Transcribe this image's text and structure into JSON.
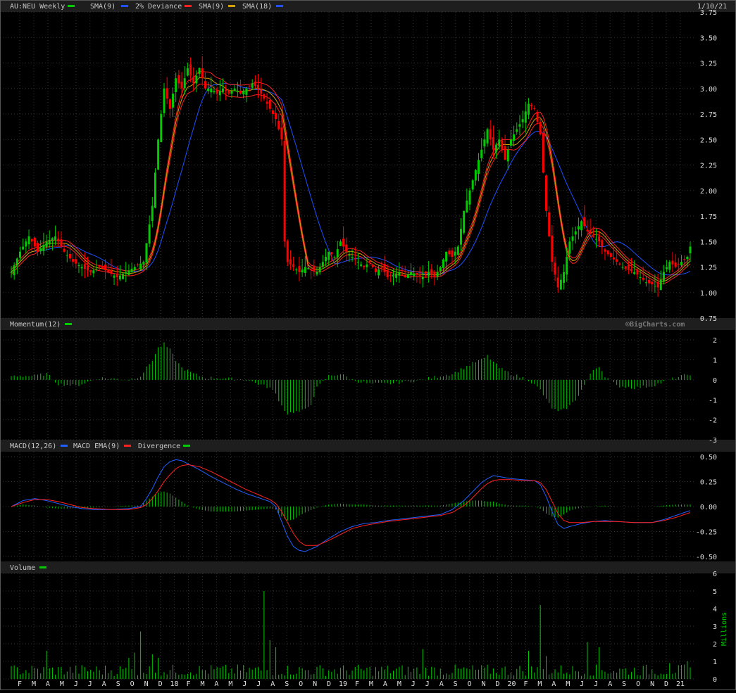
{
  "colors": {
    "bg": "#000000",
    "header_bg": "#202020",
    "grid": "#333333",
    "text": "#c8c8c8",
    "axis_text": "#e0e0e0",
    "up": "#00cc00",
    "down": "#ff0000",
    "volume": "#00cc00",
    "sma9": "#ff2020",
    "sma18": "#2050ff",
    "dev": "#d4a000",
    "macd": "#2060ff",
    "macd_ema": "#ff2020",
    "divergence": "#00cc00"
  },
  "header": {
    "price": {
      "symbol": "AU:NEU Weekly",
      "legend": [
        {
          "label": "SMA(9)",
          "color": "#00cc00"
        },
        {
          "label": "2% Deviance",
          "color": "#2050ff"
        },
        {
          "label": "SMA(9)",
          "color": "#ff2020"
        },
        {
          "label": "SMA(18)",
          "color": "#d4a000"
        }
      ],
      "last_legend_color": "#2050ff",
      "date": "1/10/21"
    },
    "momentum": {
      "label": "Momentum(12)",
      "color": "#00cc00"
    },
    "macd": {
      "legend": [
        {
          "label": "MACD(12,26)",
          "color": "#2060ff"
        },
        {
          "label": "MACD EMA(9)",
          "color": "#ff2020"
        },
        {
          "label": "Divergence",
          "color": "#00cc00"
        }
      ]
    },
    "volume": {
      "label": "Volume",
      "color": "#00cc00"
    }
  },
  "watermark": "©BigCharts.com",
  "volume_units": "Millions",
  "chart_data": [
    {
      "type": "candlestick",
      "name": "price",
      "ylim": [
        0.75,
        3.75
      ],
      "yticks": [
        "0.75",
        "1.00",
        "1.25",
        "1.50",
        "1.75",
        "2.00",
        "2.25",
        "2.50",
        "2.75",
        "3.00",
        "3.25",
        "3.50",
        "3.75"
      ],
      "anchors": [
        [
          0,
          1.2
        ],
        [
          3,
          1.4
        ],
        [
          6,
          1.55
        ],
        [
          9,
          1.4
        ],
        [
          12,
          1.5
        ],
        [
          15,
          1.55
        ],
        [
          18,
          1.4
        ],
        [
          21,
          1.3
        ],
        [
          24,
          1.25
        ],
        [
          27,
          1.2
        ],
        [
          30,
          1.25
        ],
        [
          33,
          1.2
        ],
        [
          36,
          1.15
        ],
        [
          39,
          1.2
        ],
        [
          42,
          1.25
        ],
        [
          45,
          1.3
        ],
        [
          48,
          1.85
        ],
        [
          50,
          2.5
        ],
        [
          52,
          3.0
        ],
        [
          54,
          2.8
        ],
        [
          56,
          3.1
        ],
        [
          58,
          3.0
        ],
        [
          60,
          3.2
        ],
        [
          62,
          3.05
        ],
        [
          64,
          3.2
        ],
        [
          66,
          3.0
        ],
        [
          68,
          3.0
        ],
        [
          70,
          2.95
        ],
        [
          72,
          3.0
        ],
        [
          74,
          2.95
        ],
        [
          76,
          3.0
        ],
        [
          78,
          2.95
        ],
        [
          80,
          3.0
        ],
        [
          82,
          3.05
        ],
        [
          84,
          3.0
        ],
        [
          86,
          2.9
        ],
        [
          88,
          2.8
        ],
        [
          90,
          2.7
        ],
        [
          92,
          2.5
        ],
        [
          93,
          1.5
        ],
        [
          94,
          1.3
        ],
        [
          96,
          1.25
        ],
        [
          98,
          1.2
        ],
        [
          100,
          1.25
        ],
        [
          104,
          1.2
        ],
        [
          106,
          1.3
        ],
        [
          108,
          1.4
        ],
        [
          110,
          1.35
        ],
        [
          112,
          1.5
        ],
        [
          114,
          1.4
        ],
        [
          116,
          1.35
        ],
        [
          118,
          1.3
        ],
        [
          120,
          1.25
        ],
        [
          122,
          1.3
        ],
        [
          124,
          1.2
        ],
        [
          126,
          1.25
        ],
        [
          128,
          1.15
        ],
        [
          132,
          1.2
        ],
        [
          134,
          1.15
        ],
        [
          136,
          1.2
        ],
        [
          140,
          1.15
        ],
        [
          142,
          1.2
        ],
        [
          144,
          1.15
        ],
        [
          146,
          1.25
        ],
        [
          148,
          1.4
        ],
        [
          150,
          1.35
        ],
        [
          152,
          1.45
        ],
        [
          154,
          1.8
        ],
        [
          156,
          2.0
        ],
        [
          158,
          2.2
        ],
        [
          160,
          2.4
        ],
        [
          162,
          2.6
        ],
        [
          164,
          2.4
        ],
        [
          166,
          2.5
        ],
        [
          168,
          2.3
        ],
        [
          170,
          2.5
        ],
        [
          172,
          2.6
        ],
        [
          174,
          2.7
        ],
        [
          176,
          2.85
        ],
        [
          178,
          2.8
        ],
        [
          180,
          2.55
        ],
        [
          182,
          1.8
        ],
        [
          184,
          1.3
        ],
        [
          186,
          1.05
        ],
        [
          188,
          1.2
        ],
        [
          190,
          1.5
        ],
        [
          192,
          1.6
        ],
        [
          194,
          1.7
        ],
        [
          196,
          1.6
        ],
        [
          198,
          1.55
        ],
        [
          200,
          1.5
        ],
        [
          202,
          1.4
        ],
        [
          204,
          1.35
        ],
        [
          206,
          1.3
        ],
        [
          208,
          1.25
        ],
        [
          210,
          1.22
        ],
        [
          212,
          1.2
        ],
        [
          214,
          1.15
        ],
        [
          216,
          1.1
        ],
        [
          218,
          1.08
        ],
        [
          220,
          1.05
        ],
        [
          222,
          1.2
        ],
        [
          224,
          1.3
        ],
        [
          226,
          1.25
        ],
        [
          228,
          1.3
        ],
        [
          230,
          1.35
        ],
        [
          231,
          1.45
        ]
      ]
    },
    {
      "type": "bar",
      "name": "Momentum(12)",
      "ylim": [
        -3,
        2.5
      ],
      "yticks": [
        "2",
        "1",
        "0",
        "-1",
        "-2",
        "-3"
      ],
      "anchors": [
        [
          0,
          0.2
        ],
        [
          8,
          0.2
        ],
        [
          12,
          0.3
        ],
        [
          16,
          -0.2
        ],
        [
          22,
          -0.3
        ],
        [
          30,
          0.1
        ],
        [
          40,
          0.0
        ],
        [
          44,
          0.2
        ],
        [
          46,
          0.6
        ],
        [
          48,
          1.0
        ],
        [
          50,
          1.6
        ],
        [
          52,
          1.8
        ],
        [
          54,
          1.5
        ],
        [
          56,
          1.0
        ],
        [
          58,
          0.6
        ],
        [
          62,
          0.3
        ],
        [
          66,
          0.1
        ],
        [
          70,
          0.1
        ],
        [
          80,
          0.0
        ],
        [
          84,
          -0.2
        ],
        [
          88,
          -0.4
        ],
        [
          90,
          -0.7
        ],
        [
          92,
          -1.3
        ],
        [
          94,
          -1.7
        ],
        [
          96,
          -1.6
        ],
        [
          98,
          -1.6
        ],
        [
          100,
          -1.5
        ],
        [
          102,
          -1.2
        ],
        [
          104,
          -0.4
        ],
        [
          108,
          0.2
        ],
        [
          112,
          0.3
        ],
        [
          116,
          0.0
        ],
        [
          122,
          -0.2
        ],
        [
          128,
          -0.2
        ],
        [
          134,
          -0.1
        ],
        [
          140,
          0.0
        ],
        [
          146,
          0.2
        ],
        [
          150,
          0.3
        ],
        [
          154,
          0.6
        ],
        [
          158,
          0.9
        ],
        [
          160,
          1.0
        ],
        [
          162,
          1.2
        ],
        [
          164,
          0.9
        ],
        [
          166,
          0.6
        ],
        [
          170,
          0.3
        ],
        [
          176,
          0.0
        ],
        [
          180,
          -0.5
        ],
        [
          182,
          -1.0
        ],
        [
          184,
          -1.4
        ],
        [
          186,
          -1.6
        ],
        [
          188,
          -1.5
        ],
        [
          190,
          -1.3
        ],
        [
          192,
          -1.0
        ],
        [
          194,
          -0.5
        ],
        [
          196,
          0.0
        ],
        [
          198,
          0.5
        ],
        [
          200,
          0.7
        ],
        [
          202,
          0.2
        ],
        [
          206,
          -0.3
        ],
        [
          212,
          -0.4
        ],
        [
          218,
          -0.3
        ],
        [
          222,
          -0.1
        ],
        [
          226,
          0.1
        ],
        [
          231,
          0.3
        ]
      ]
    },
    {
      "type": "line",
      "name": "MACD(12,26)",
      "ylim": [
        -0.55,
        0.55
      ],
      "yticks": [
        "0.50",
        "0.25",
        "0.00",
        "-0.25",
        "-0.50"
      ],
      "macd": [
        [
          0,
          0.0
        ],
        [
          4,
          0.06
        ],
        [
          8,
          0.08
        ],
        [
          12,
          0.06
        ],
        [
          16,
          0.03
        ],
        [
          20,
          0.0
        ],
        [
          24,
          -0.02
        ],
        [
          28,
          -0.03
        ],
        [
          34,
          -0.03
        ],
        [
          40,
          -0.02
        ],
        [
          44,
          0.0
        ],
        [
          46,
          0.08
        ],
        [
          48,
          0.18
        ],
        [
          50,
          0.3
        ],
        [
          52,
          0.4
        ],
        [
          54,
          0.45
        ],
        [
          56,
          0.47
        ],
        [
          58,
          0.46
        ],
        [
          60,
          0.43
        ],
        [
          64,
          0.37
        ],
        [
          68,
          0.3
        ],
        [
          72,
          0.24
        ],
        [
          76,
          0.18
        ],
        [
          80,
          0.13
        ],
        [
          84,
          0.09
        ],
        [
          88,
          0.05
        ],
        [
          90,
          0.0
        ],
        [
          92,
          -0.15
        ],
        [
          94,
          -0.3
        ],
        [
          96,
          -0.4
        ],
        [
          98,
          -0.44
        ],
        [
          100,
          -0.45
        ],
        [
          104,
          -0.4
        ],
        [
          108,
          -0.32
        ],
        [
          112,
          -0.25
        ],
        [
          116,
          -0.2
        ],
        [
          120,
          -0.17
        ],
        [
          124,
          -0.16
        ],
        [
          128,
          -0.14
        ],
        [
          134,
          -0.12
        ],
        [
          140,
          -0.1
        ],
        [
          146,
          -0.08
        ],
        [
          150,
          -0.03
        ],
        [
          154,
          0.06
        ],
        [
          156,
          0.12
        ],
        [
          158,
          0.18
        ],
        [
          160,
          0.24
        ],
        [
          162,
          0.28
        ],
        [
          164,
          0.31
        ],
        [
          166,
          0.3
        ],
        [
          170,
          0.28
        ],
        [
          174,
          0.27
        ],
        [
          178,
          0.26
        ],
        [
          180,
          0.22
        ],
        [
          182,
          0.1
        ],
        [
          184,
          -0.05
        ],
        [
          186,
          -0.18
        ],
        [
          188,
          -0.22
        ],
        [
          190,
          -0.2
        ],
        [
          194,
          -0.17
        ],
        [
          198,
          -0.15
        ],
        [
          202,
          -0.14
        ],
        [
          206,
          -0.15
        ],
        [
          212,
          -0.16
        ],
        [
          218,
          -0.16
        ],
        [
          222,
          -0.13
        ],
        [
          226,
          -0.09
        ],
        [
          231,
          -0.04
        ]
      ],
      "ema": [
        [
          0,
          0.0
        ],
        [
          4,
          0.04
        ],
        [
          8,
          0.07
        ],
        [
          12,
          0.07
        ],
        [
          16,
          0.05
        ],
        [
          20,
          0.02
        ],
        [
          24,
          -0.01
        ],
        [
          28,
          -0.02
        ],
        [
          34,
          -0.03
        ],
        [
          40,
          -0.03
        ],
        [
          44,
          -0.01
        ],
        [
          46,
          0.02
        ],
        [
          48,
          0.08
        ],
        [
          50,
          0.16
        ],
        [
          52,
          0.25
        ],
        [
          54,
          0.32
        ],
        [
          56,
          0.38
        ],
        [
          58,
          0.41
        ],
        [
          60,
          0.42
        ],
        [
          64,
          0.4
        ],
        [
          68,
          0.35
        ],
        [
          72,
          0.29
        ],
        [
          76,
          0.23
        ],
        [
          80,
          0.17
        ],
        [
          84,
          0.12
        ],
        [
          88,
          0.07
        ],
        [
          90,
          0.03
        ],
        [
          92,
          -0.05
        ],
        [
          94,
          -0.16
        ],
        [
          96,
          -0.27
        ],
        [
          98,
          -0.35
        ],
        [
          100,
          -0.39
        ],
        [
          104,
          -0.39
        ],
        [
          108,
          -0.34
        ],
        [
          112,
          -0.28
        ],
        [
          116,
          -0.22
        ],
        [
          120,
          -0.19
        ],
        [
          124,
          -0.17
        ],
        [
          128,
          -0.15
        ],
        [
          134,
          -0.13
        ],
        [
          140,
          -0.11
        ],
        [
          146,
          -0.09
        ],
        [
          150,
          -0.06
        ],
        [
          154,
          0.01
        ],
        [
          156,
          0.06
        ],
        [
          158,
          0.12
        ],
        [
          160,
          0.18
        ],
        [
          162,
          0.23
        ],
        [
          164,
          0.26
        ],
        [
          166,
          0.27
        ],
        [
          170,
          0.27
        ],
        [
          174,
          0.26
        ],
        [
          178,
          0.26
        ],
        [
          180,
          0.24
        ],
        [
          182,
          0.17
        ],
        [
          184,
          0.05
        ],
        [
          186,
          -0.07
        ],
        [
          188,
          -0.14
        ],
        [
          190,
          -0.16
        ],
        [
          194,
          -0.16
        ],
        [
          198,
          -0.15
        ],
        [
          202,
          -0.15
        ],
        [
          206,
          -0.15
        ],
        [
          212,
          -0.16
        ],
        [
          218,
          -0.16
        ],
        [
          222,
          -0.14
        ],
        [
          226,
          -0.11
        ],
        [
          231,
          -0.06
        ]
      ]
    },
    {
      "type": "bar",
      "name": "Volume",
      "ylim": [
        0,
        6
      ],
      "yticks": [
        "6",
        "5",
        "4",
        "3",
        "2",
        "1",
        "0"
      ],
      "values": {
        "86": 5.0,
        "88": 2.2,
        "90": 1.8,
        "44": 2.7,
        "40": 1.2,
        "42": 1.5,
        "12": 1.6,
        "48": 1.4,
        "50": 1.2,
        "180": 4.2,
        "182": 1.3,
        "196": 2.1,
        "200": 1.8,
        "176": 1.6,
        "140": 1.7,
        "224": 0.9,
        "230": 1.0
      },
      "base": 0.55
    },
    {
      "type": "axis",
      "name": "months",
      "labels": [
        "F",
        "M",
        "A",
        "M",
        "J",
        "J",
        "A",
        "S",
        "O",
        "N",
        "D",
        "18",
        "F",
        "M",
        "A",
        "M",
        "J",
        "J",
        "A",
        "S",
        "O",
        "N",
        "D",
        "19",
        "F",
        "M",
        "A",
        "M",
        "J",
        "J",
        "A",
        "S",
        "O",
        "N",
        "D",
        "20",
        "F",
        "M",
        "A",
        "M",
        "J",
        "J",
        "A",
        "S",
        "O",
        "N",
        "D",
        "21"
      ]
    }
  ]
}
